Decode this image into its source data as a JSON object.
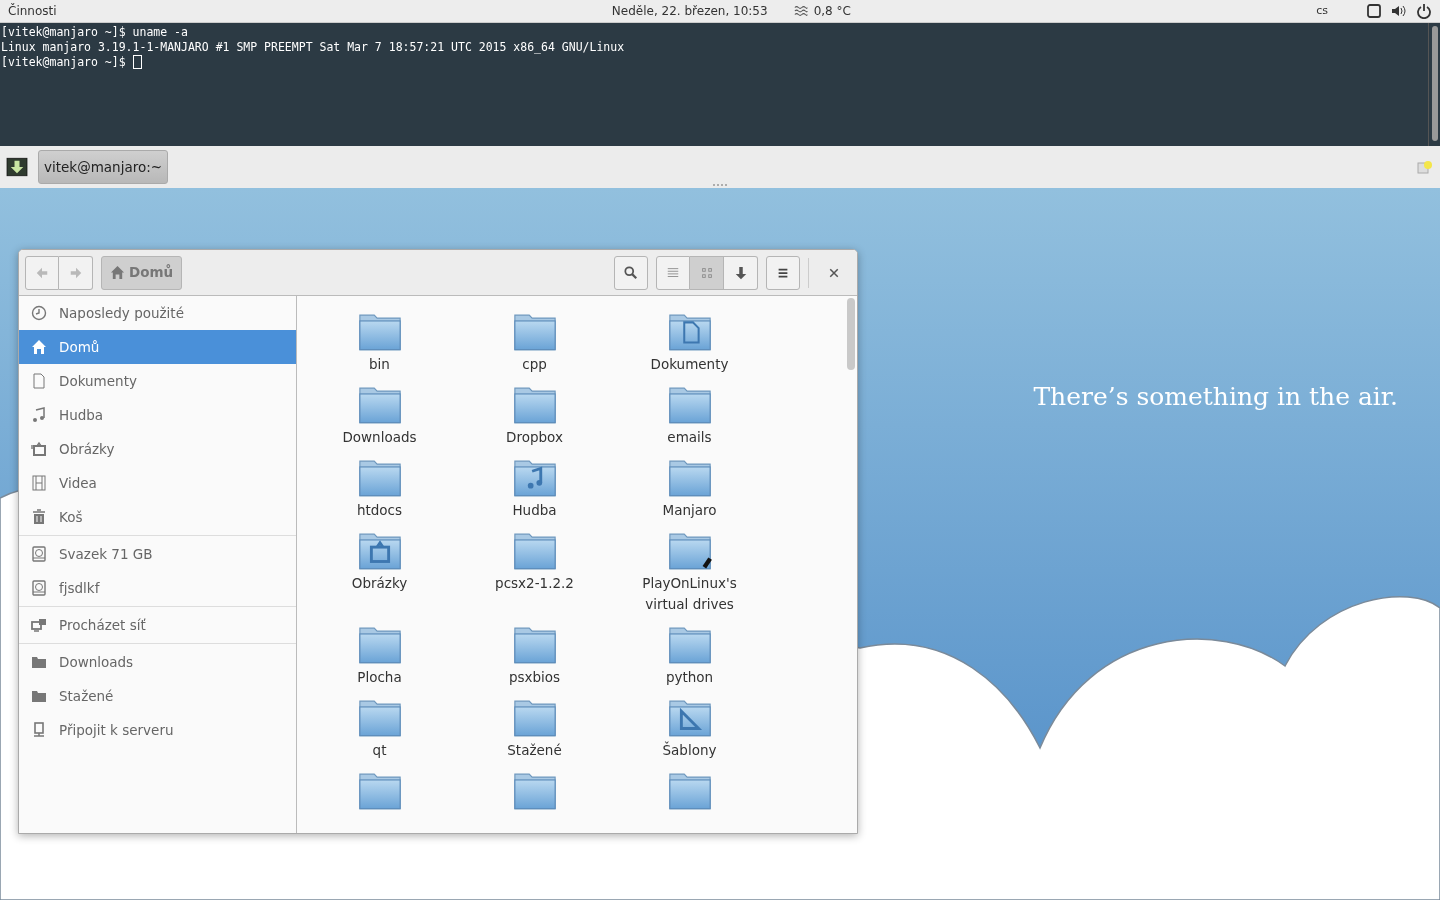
{
  "top_bar": {
    "activities": "Činnosti",
    "clock": "Neděle, 22. březen, 10:53",
    "weather": "0,8 °C",
    "keyboard_layout": "cs"
  },
  "terminal": {
    "lines": [
      "[vitek@manjaro ~]$ uname -a",
      "Linux manjaro 3.19.1-1-MANJARO #1 SMP PREEMPT Sat Mar 7 18:57:21 UTC 2015 x86_64 GNU/Linux",
      "[vitek@manjaro ~]$ "
    ]
  },
  "taskbar": {
    "windows": [
      {
        "label": "vitek@manjaro:~",
        "selected": true
      }
    ]
  },
  "desktop": {
    "slogan": "There’s something in the air."
  },
  "file_manager": {
    "toolbar": {
      "back_disabled": true,
      "forward_disabled": true,
      "path": [
        {
          "label": "Domů",
          "selected": true
        }
      ],
      "views": [
        {
          "kind": "list",
          "selected": false
        },
        {
          "kind": "grid",
          "selected": true
        }
      ]
    },
    "sidebar": [
      [
        {
          "label": "Naposledy použité",
          "kind": "clock",
          "selected": false
        },
        {
          "label": "Domů",
          "kind": "home",
          "selected": true
        },
        {
          "label": "Dokumenty",
          "kind": "document",
          "selected": false
        },
        {
          "label": "Hudba",
          "kind": "music",
          "selected": false
        },
        {
          "label": "Obrázky",
          "kind": "picture",
          "selected": false
        },
        {
          "label": "Videa",
          "kind": "film",
          "selected": false
        },
        {
          "label": "Koš",
          "kind": "trash",
          "selected": false
        }
      ],
      [
        {
          "label": "Svazek 71 GB",
          "kind": "drive",
          "selected": false
        },
        {
          "label": "fjsdlkf",
          "kind": "drive",
          "selected": false
        }
      ],
      [
        {
          "label": "Procházet síť",
          "kind": "network",
          "selected": false
        }
      ],
      [
        {
          "label": "Downloads",
          "kind": "folder",
          "selected": false
        },
        {
          "label": "Stažené",
          "kind": "folder",
          "selected": false
        },
        {
          "label": "Připojit k serveru",
          "kind": "server",
          "selected": false
        }
      ]
    ],
    "files": [
      {
        "name": "bin",
        "kind": "folder"
      },
      {
        "name": "cpp",
        "kind": "folder"
      },
      {
        "name": "Dokumenty",
        "kind": "documents"
      },
      {
        "name": "Downloads",
        "kind": "folder"
      },
      {
        "name": "Dropbox",
        "kind": "folder"
      },
      {
        "name": "emails",
        "kind": "folder"
      },
      {
        "name": "htdocs",
        "kind": "folder"
      },
      {
        "name": "Hudba",
        "kind": "music"
      },
      {
        "name": "Manjaro",
        "kind": "folder"
      },
      {
        "name": "Obrázky",
        "kind": "pictures"
      },
      {
        "name": "pcsx2-1.2.2",
        "kind": "folder"
      },
      {
        "name": "PlayOnLinux's virtual drives",
        "kind": "link"
      },
      {
        "name": "Plocha",
        "kind": "folder"
      },
      {
        "name": "psxbios",
        "kind": "folder"
      },
      {
        "name": "python",
        "kind": "folder"
      },
      {
        "name": "qt",
        "kind": "folder"
      },
      {
        "name": "Stažené",
        "kind": "folder"
      },
      {
        "name": "Šablony",
        "kind": "templates"
      },
      {
        "kind": "folder"
      },
      {
        "kind": "folder"
      },
      {
        "kind": "folder"
      }
    ]
  }
}
